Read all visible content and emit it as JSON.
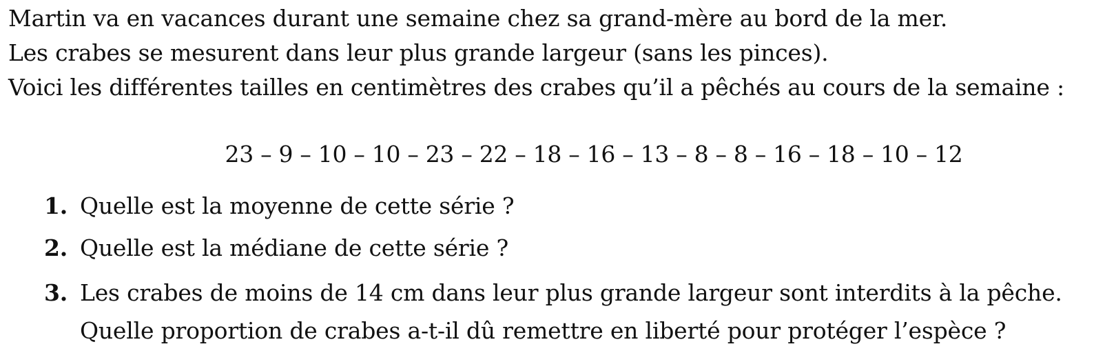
{
  "intro": {
    "line1": "Martin va en vacances durant une semaine chez sa grand-mère au bord de la mer.",
    "line2": "Les crabes se mesurent dans leur plus grande largeur (sans les pinces).",
    "line3": "Voici les différentes tailles en centimètres des crabes qu’il a pêchés au cours de la semaine :"
  },
  "series": {
    "text": "23 – 9 – 10 – 10 – 23 – 22 – 18 – 16 – 13 – 8 – 8 – 16 – 18 – 10 – 12"
  },
  "questions": [
    {
      "number": "1.",
      "text": "Quelle est la moyenne de cette série ?"
    },
    {
      "number": "2.",
      "text": "Quelle est la médiane de cette série ?"
    },
    {
      "number": "3.",
      "text": "Les crabes de moins de 14 cm dans leur plus grande largeur sont interdits à la pêche.",
      "text_line2": "Quelle proportion de crabes a-t-il dû remettre en liberté pour protéger l’espèce ?"
    }
  ]
}
